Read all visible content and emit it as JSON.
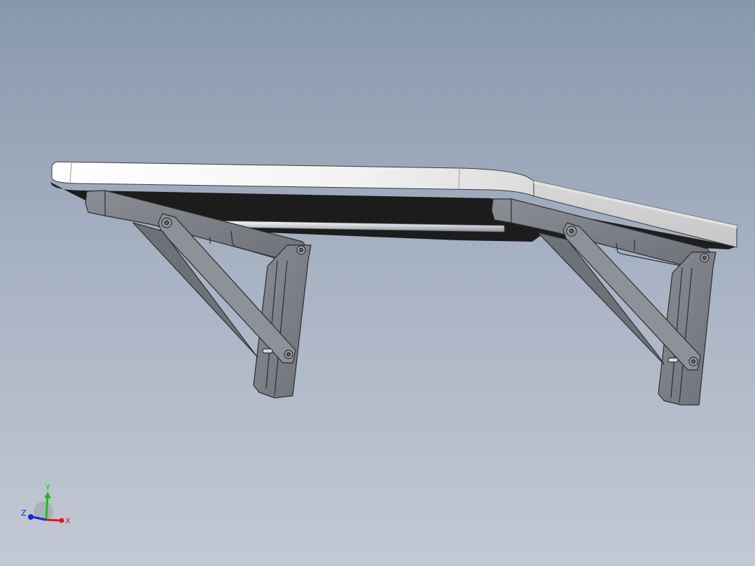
{
  "viewport": {
    "background_top": "#8898ac",
    "background_bottom": "#c3c9d4"
  },
  "model": {
    "top_color": "#f2f3f4",
    "underside_color": "#1c1c1c",
    "bracket_color": "#7c7f86",
    "rod_color": "#cfd3d8"
  },
  "triad": {
    "x_label": "X",
    "y_label": "Y",
    "z_label": "Z",
    "x_color": "#e01818",
    "y_color": "#18c018",
    "z_color": "#1a2ad0"
  }
}
